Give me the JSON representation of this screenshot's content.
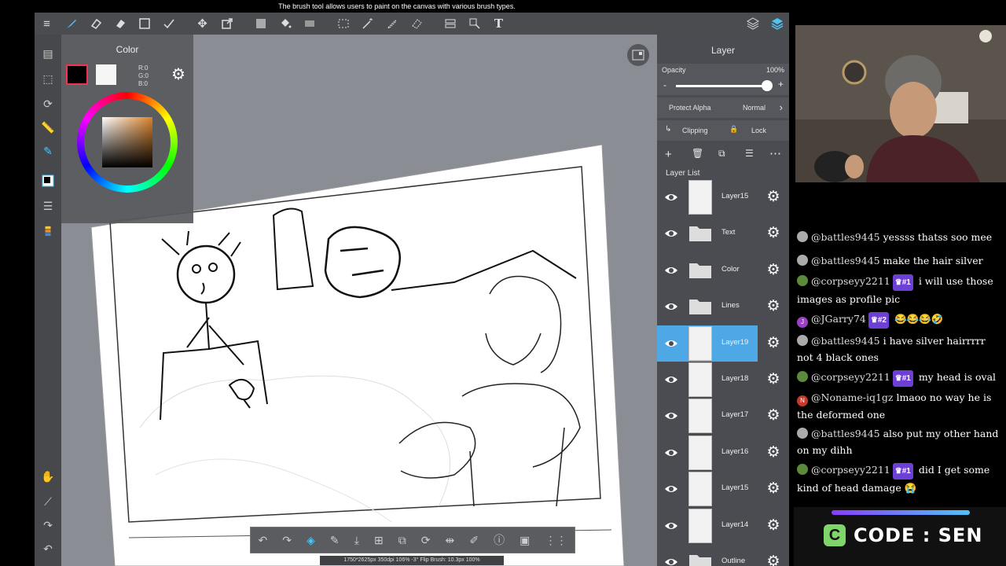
{
  "tooltip": "The brush tool allows users to paint on the canvas with various brush types.",
  "toolbar": {
    "text_tool_label": "T"
  },
  "color_panel": {
    "title": "Color",
    "r": "R:0",
    "g": "G:0",
    "b": "B:0",
    "fg_color": "#000000",
    "bg_color": "#ffffff"
  },
  "layer_panel": {
    "title": "Layer",
    "opacity_label": "Opacity",
    "opacity_value": "100%",
    "opacity_fraction": 1.0,
    "minus": "-",
    "plus": "+",
    "protect_alpha": "Protect Alpha",
    "blend_mode": "Normal",
    "clipping": "Clipping",
    "lock": "Lock",
    "layer_list_label": "Layer List",
    "layers": [
      {
        "name": "Layer15",
        "type": "layer"
      },
      {
        "name": "Text",
        "type": "folder"
      },
      {
        "name": "Color",
        "type": "folder"
      },
      {
        "name": "Lines",
        "type": "folder"
      },
      {
        "name": "Layer19",
        "type": "layer",
        "selected": true
      },
      {
        "name": "Layer18",
        "type": "layer"
      },
      {
        "name": "Layer17",
        "type": "layer"
      },
      {
        "name": "Layer16",
        "type": "layer"
      },
      {
        "name": "Layer15",
        "type": "layer"
      },
      {
        "name": "Layer14",
        "type": "layer"
      },
      {
        "name": "Outline",
        "type": "folder"
      }
    ]
  },
  "status_bar": "1750*2625px 350dpi 106% -3° Flip Brush: 10.3px 100%",
  "chat": [
    {
      "user": "@battles9445",
      "text": "yessss thatss soo mee",
      "avatar": "#aaaaaa",
      "badge": ""
    },
    {
      "user": "@battles9445",
      "text": "make the hair silver",
      "avatar": "#aaaaaa",
      "badge": ""
    },
    {
      "user": "@corpseyy2211",
      "text": "i will use those images as profile pic",
      "avatar": "#5a8a3a",
      "badge": "♛#1"
    },
    {
      "user": "@JGarry74",
      "text": "😂😂😂🤣",
      "avatar": "#9b3fc4",
      "avatar_letter": "J",
      "badge": "♛#2"
    },
    {
      "user": "@battles9445",
      "text": "i have silver hairrrrr not 4 black ones",
      "avatar": "#aaaaaa",
      "badge": ""
    },
    {
      "user": "@corpseyy2211",
      "text": "my head is oval",
      "avatar": "#5a8a3a",
      "badge": "♛#1"
    },
    {
      "user": "@Noname-iq1gz",
      "text": "lmaoo no way he is the deformed one",
      "avatar": "#c43a2a",
      "avatar_letter": "N",
      "badge": ""
    },
    {
      "user": "@battles9445",
      "text": "also put my other hand on my dihh",
      "avatar": "#aaaaaa",
      "badge": ""
    },
    {
      "user": "@corpseyy2211",
      "text": "did I get some kind of head damage 😭",
      "avatar": "#5a8a3a",
      "badge": "♛#1"
    }
  ],
  "code_banner": {
    "text": "CODE : SEN",
    "logo_letter": "C"
  }
}
